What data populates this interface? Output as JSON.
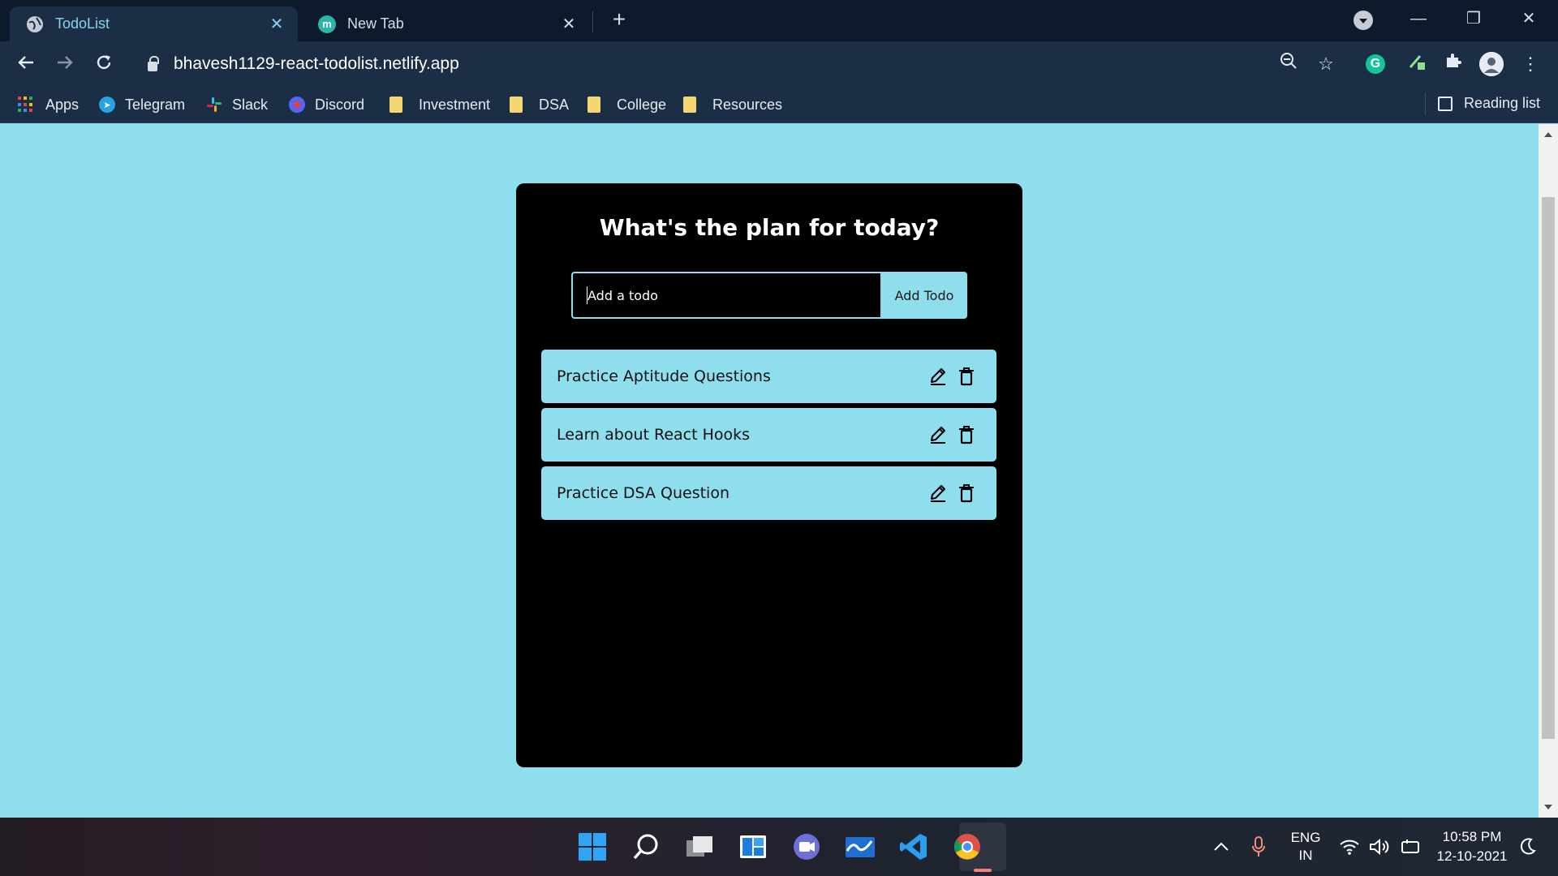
{
  "browser": {
    "tabs": [
      {
        "title": "TodoList",
        "active": true
      },
      {
        "title": "New Tab",
        "active": false,
        "favicon_letter": "m"
      }
    ],
    "new_tab_label": "+",
    "window_controls": {
      "minimize": "—",
      "restore": "❐",
      "close": "✕"
    },
    "url": "bhavesh1129-react-todolist.netlify.app",
    "bookmarks": [
      {
        "label": "Apps"
      },
      {
        "label": "Telegram"
      },
      {
        "label": "Slack"
      },
      {
        "label": "Discord"
      },
      {
        "label": "Investment"
      },
      {
        "label": "DSA"
      },
      {
        "label": "College"
      },
      {
        "label": "Resources"
      }
    ],
    "reading_list_label": "Reading list"
  },
  "app": {
    "heading": "What's the plan for today?",
    "input_placeholder": "Add a todo",
    "add_button_label": "Add Todo",
    "todos": [
      {
        "text": "Practice Aptitude Questions"
      },
      {
        "text": "Learn about React Hooks"
      },
      {
        "text": "Practice DSA Question"
      }
    ],
    "colors": {
      "page_bg": "#8fdeee",
      "card_bg": "#000000"
    }
  },
  "taskbar": {
    "language": "ENG",
    "region": "IN",
    "time": "10:58 PM",
    "date": "12-10-2021"
  }
}
